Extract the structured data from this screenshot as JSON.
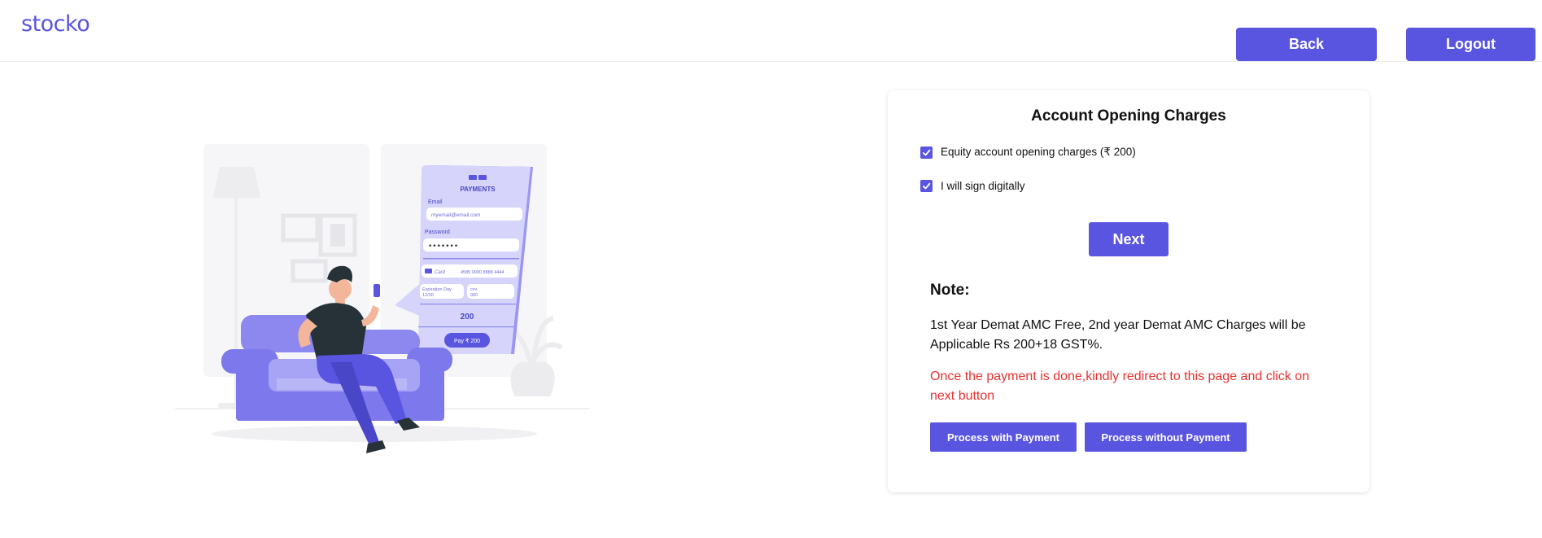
{
  "header": {
    "logo": "stocko",
    "back_label": "Back",
    "logout_label": "Logout"
  },
  "illustration": {
    "payments_title": "PAYMENTS",
    "email_label": "Email",
    "email_value": "myemail@email.com",
    "password_label": "Password",
    "password_value": "•••••••",
    "card_label": "Card",
    "card_number": "4585 0000 8888 4444",
    "expiration_label": "Expiration Day",
    "expiration_value": "12/30",
    "cvv_label": "cvv",
    "cvv_value": "000",
    "amount": "200",
    "pay_label": "Pay ₹ 200"
  },
  "card": {
    "title": "Account Opening Charges",
    "options": [
      {
        "label": "Equity account opening charges (₹ 200)",
        "checked": true
      },
      {
        "label": "I will sign digitally",
        "checked": true
      }
    ],
    "next_label": "Next",
    "note_title": "Note:",
    "note_text": "1st Year Demat AMC Free, 2nd year Demat AMC Charges will be Applicable Rs 200+18 GST%.",
    "note_warning": "Once the payment is done,kindly redirect to this page and click on next button",
    "process_with_label": "Process with Payment",
    "process_without_label": "Process without Payment"
  },
  "colors": {
    "accent": "#5a55e0",
    "warning": "#e8312f"
  }
}
